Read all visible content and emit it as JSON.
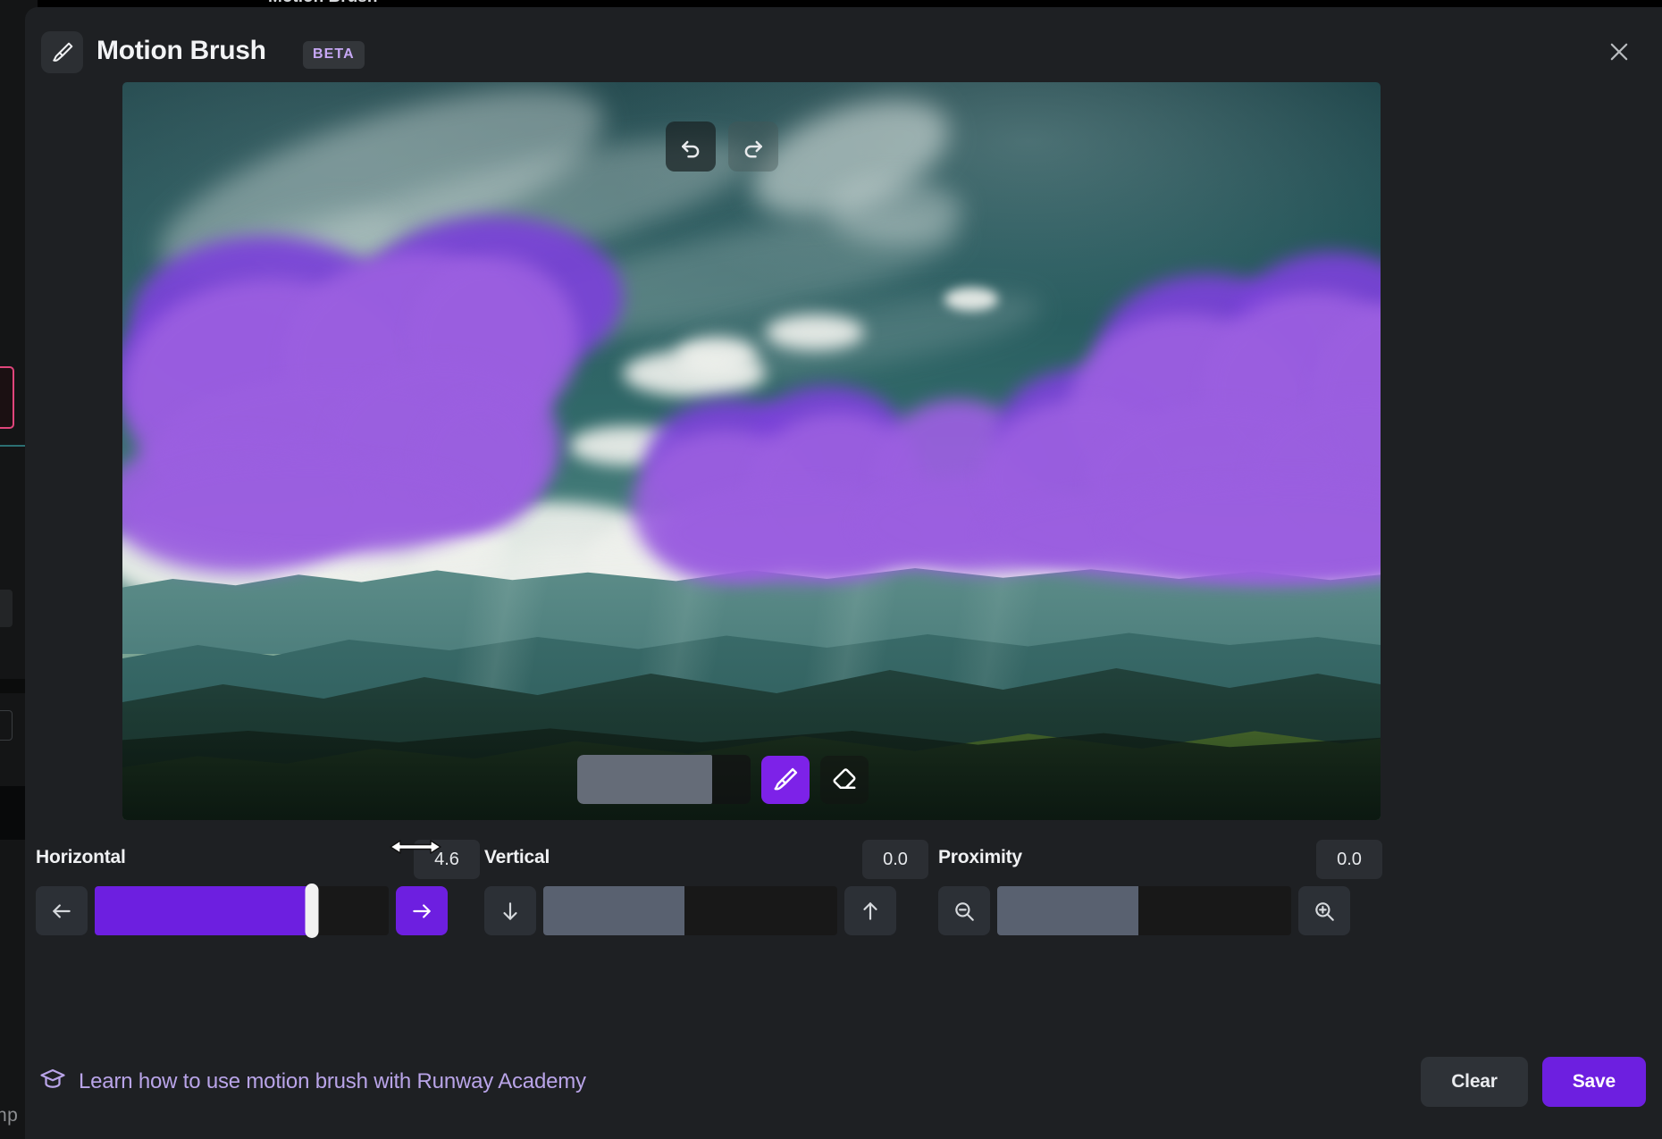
{
  "background": {
    "cut_text": "Motion Brush",
    "sliver_label": "np"
  },
  "header": {
    "title": "Motion Brush",
    "badge": "BETA",
    "brush_icon": "paint-brush-icon",
    "close_icon": "close-icon"
  },
  "canvas": {
    "undo_label": "undo-icon",
    "redo_label": "redo-icon",
    "tools": {
      "brush": "paint-brush-icon",
      "eraser": "eraser-icon",
      "brush_size_percent": 78
    },
    "scene": {
      "description": "Mountain landscape with teal sky and clouds",
      "mask_color": "#9b5fe0"
    }
  },
  "params": [
    {
      "label": "Horizontal",
      "value": "4.6",
      "fill_percent": 74,
      "fill_color": "purple",
      "dec_icon": "arrow-left-icon",
      "inc_icon": "arrow-right-icon",
      "inc_active": true,
      "dec_active": false,
      "has_thumb": true,
      "has_cursor": true
    },
    {
      "label": "Vertical",
      "value": "0.0",
      "fill_percent": 48,
      "fill_color": "grey",
      "dec_icon": "arrow-down-icon",
      "inc_icon": "arrow-up-icon",
      "inc_active": false,
      "dec_active": false,
      "has_thumb": false,
      "has_cursor": false
    },
    {
      "label": "Proximity",
      "value": "0.0",
      "fill_percent": 48,
      "fill_color": "grey",
      "dec_icon": "zoom-out-icon",
      "inc_icon": "zoom-in-icon",
      "inc_active": false,
      "dec_active": false,
      "has_thumb": false,
      "has_cursor": false
    }
  ],
  "footer": {
    "academy_text": "Learn how to use motion brush with Runway Academy",
    "academy_icon": "graduation-cap-icon",
    "clear_label": "Clear",
    "save_label": "Save"
  },
  "colors": {
    "accent_purple": "#6d1fe0",
    "mask_purple": "#9b5fe0",
    "panel_bg": "#1e2023",
    "link_purple": "#b9a4e8"
  }
}
